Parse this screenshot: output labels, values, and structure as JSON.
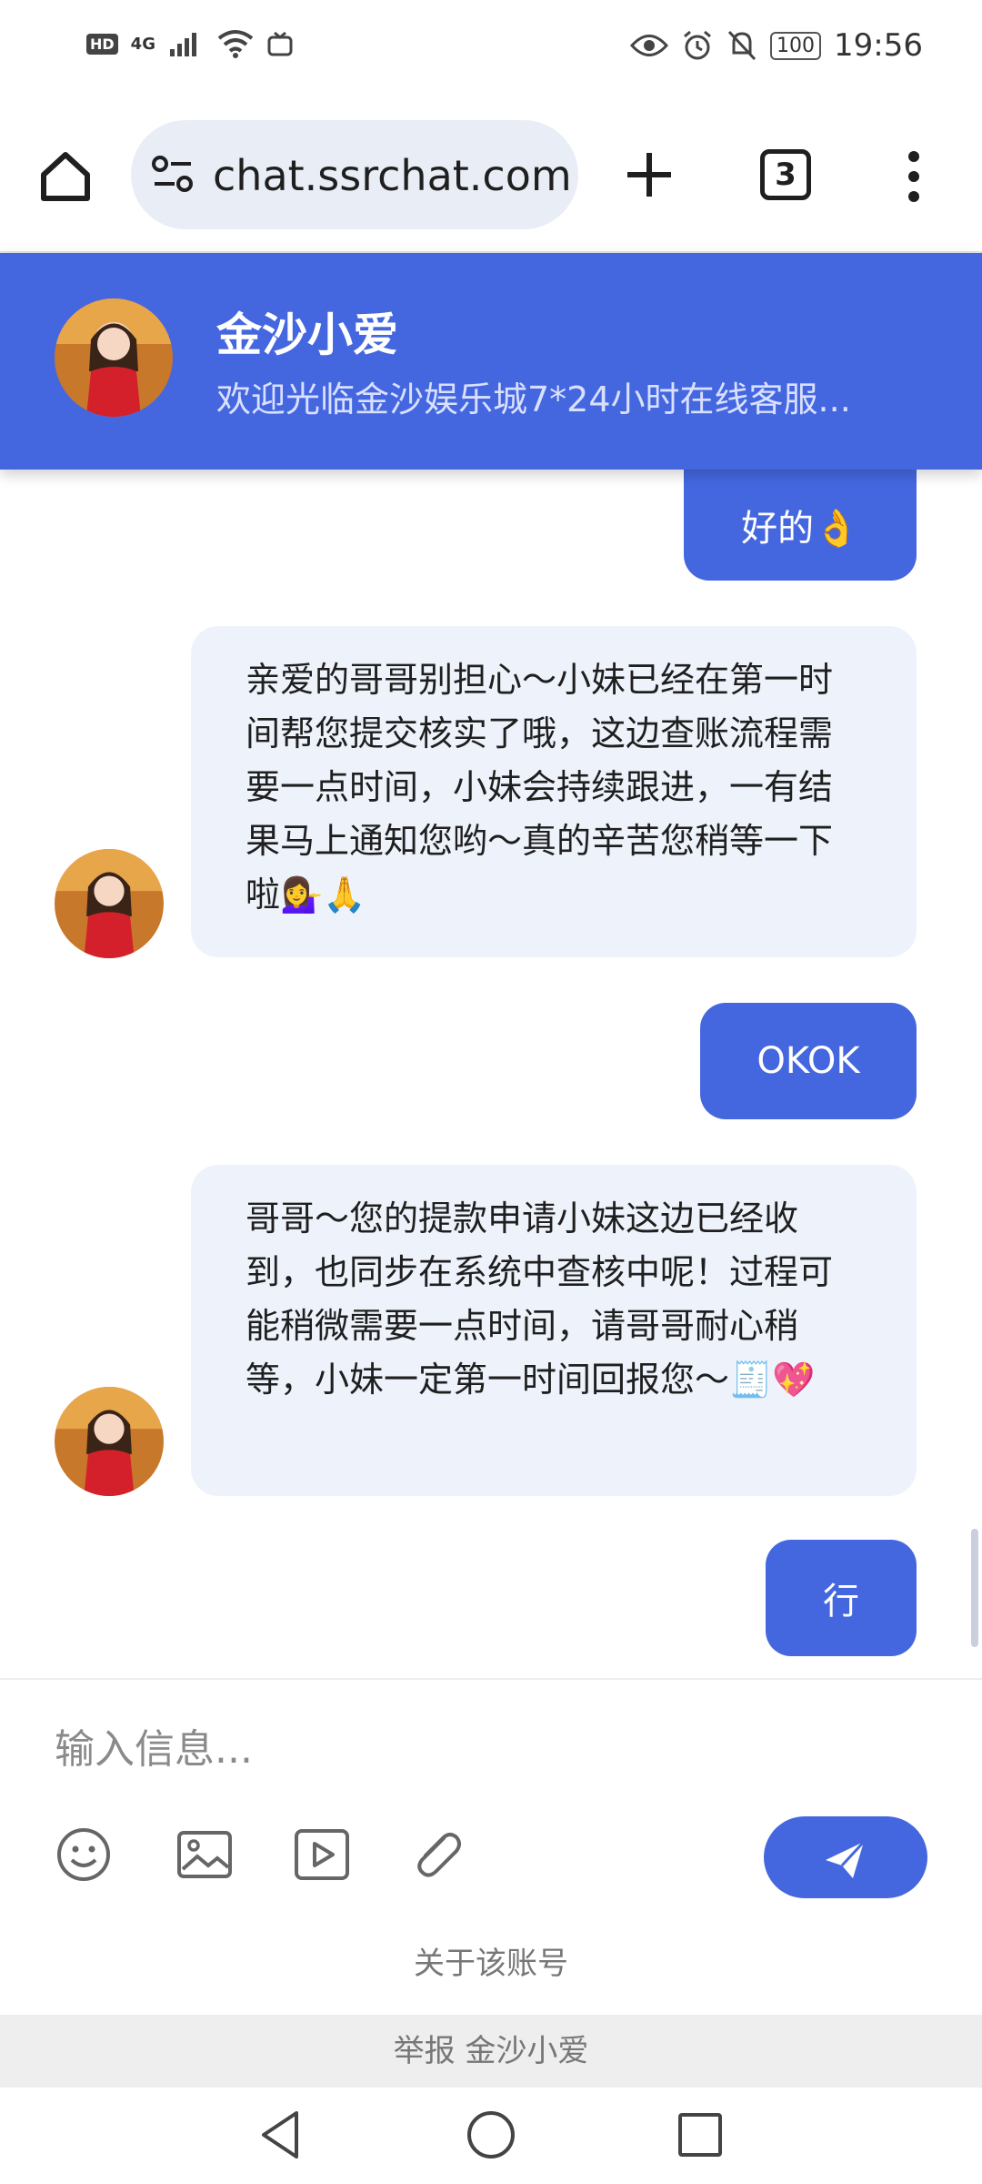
{
  "status_bar": {
    "hd": "HD",
    "network": "4G",
    "battery": "100",
    "time": "19:56"
  },
  "browser": {
    "url": "chat.ssrchat.com",
    "tab_count": "3"
  },
  "chat_header": {
    "name": "金沙小爱",
    "subtitle": "欢迎光临金沙娱乐城7*24小时在线客服..."
  },
  "messages": [
    {
      "from": "user",
      "text": "好的👌"
    },
    {
      "from": "agent",
      "text": "亲爱的哥哥别担心～小妹已经在第一时间帮您提交核实了哦，这边查账流程需要一点时间，小妹会持续跟进，一有结果马上通知您哟～真的辛苦您稍等一下啦💁‍♀️🙏"
    },
    {
      "from": "user",
      "text": "OKOK"
    },
    {
      "from": "agent",
      "text": "哥哥～您的提款申请小妹这边已经收到，也同步在系统中查核中呢！过程可能稍微需要一点时间，请哥哥耐心稍等，小妹一定第一时间回报您～🧾💖"
    },
    {
      "from": "user",
      "text": "行"
    }
  ],
  "input": {
    "placeholder": "输入信息..."
  },
  "tools": [
    "emoji-icon",
    "image-icon",
    "video-icon",
    "attachment-icon"
  ],
  "about_link": "关于该账号",
  "report_bar": "举报 金沙小爱",
  "colors": {
    "accent": "#4467e0",
    "incoming_bubble": "#eef3fb"
  }
}
